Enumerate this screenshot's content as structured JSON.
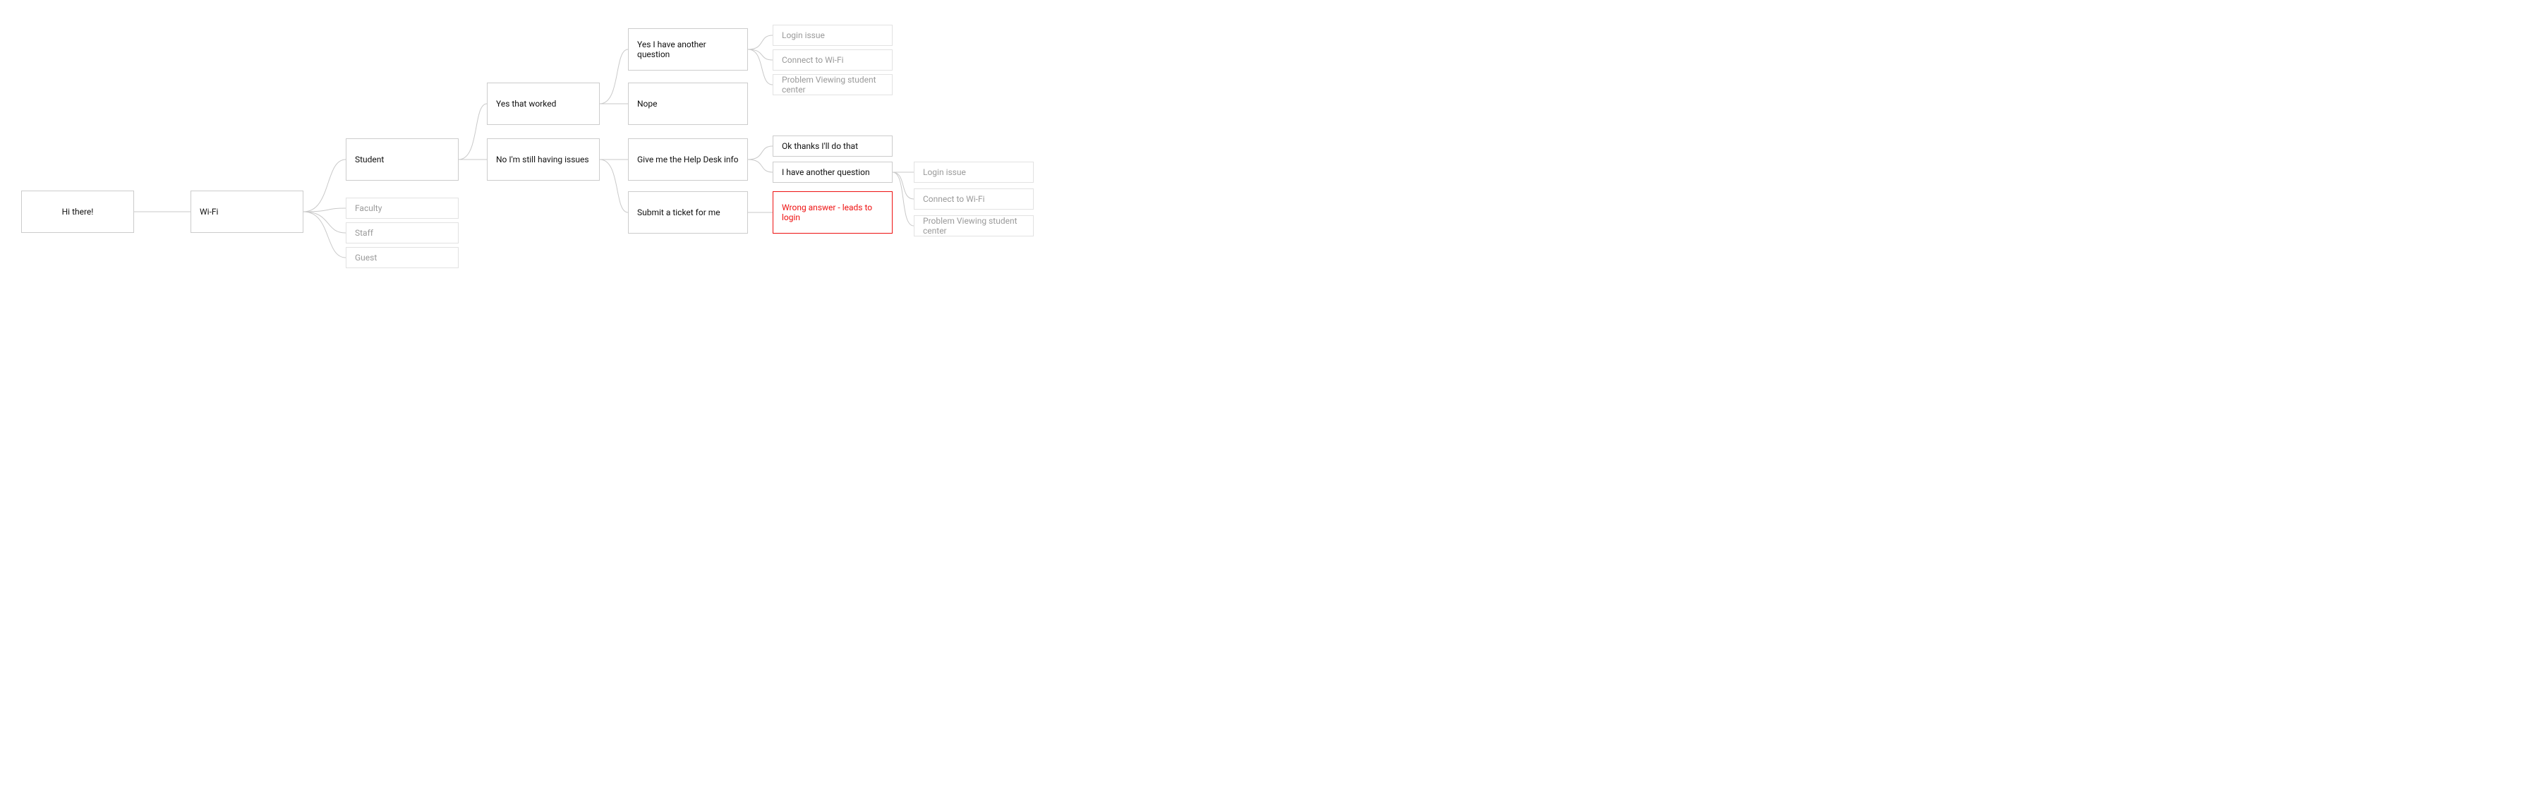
{
  "nodes": {
    "hi": {
      "label": "Hi there!"
    },
    "wifi": {
      "label": "Wi-Fi"
    },
    "student": {
      "label": "Student"
    },
    "faculty": {
      "label": "Faculty"
    },
    "staff": {
      "label": "Staff"
    },
    "guest": {
      "label": "Guest"
    },
    "yes_worked": {
      "label": "Yes that worked"
    },
    "still": {
      "label": "No I'm still having issues"
    },
    "another_q": {
      "label": "Yes I have another question"
    },
    "nope": {
      "label": "Nope"
    },
    "helpdesk": {
      "label": "Give me the Help Desk info"
    },
    "submit": {
      "label": "Submit a ticket for me"
    },
    "okthanks": {
      "label": "Ok thanks I'll do that"
    },
    "have_q": {
      "label": "I have another question"
    },
    "wrong": {
      "label": "Wrong answer - leads to login"
    },
    "login1": {
      "label": "Login issue"
    },
    "conn1": {
      "label": "Connect to Wi-Fi"
    },
    "pvsc1": {
      "label": "Problem Viewing student center"
    },
    "login2": {
      "label": "Login issue"
    },
    "conn2": {
      "label": "Connect to Wi-Fi"
    },
    "pvsc2": {
      "label": "Problem Viewing student center"
    }
  }
}
